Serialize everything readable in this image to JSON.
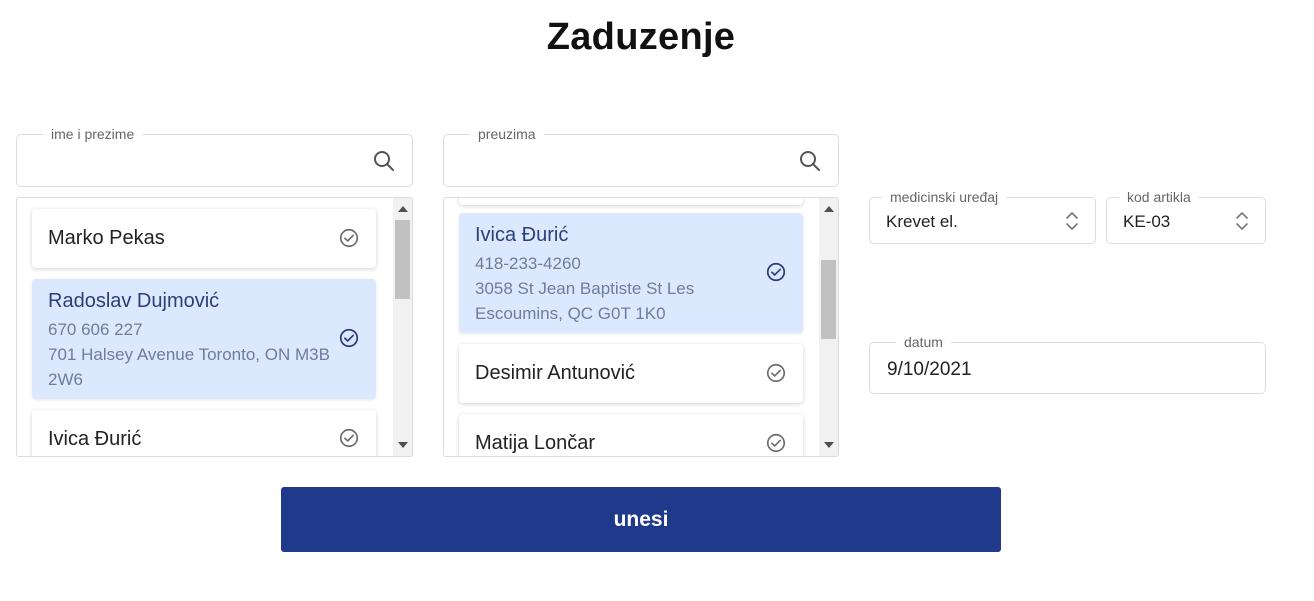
{
  "page": {
    "title": "Zaduzenje"
  },
  "left_search": {
    "label": "ime i prezime",
    "value": "",
    "placeholder": ""
  },
  "right_search": {
    "label": "preuzima",
    "value": "",
    "placeholder": ""
  },
  "left_list": {
    "items": [
      {
        "name": "Marko Pekas",
        "phone": "",
        "address1": "",
        "address2": "",
        "selected": false
      },
      {
        "name": "Radoslav Dujmović",
        "phone": "670 606 227",
        "address1": "701 Halsey Avenue Toronto, ON M3B",
        "address2": "2W6",
        "selected": true
      },
      {
        "name": "Ivica Đurić",
        "phone": "",
        "address1": "",
        "address2": "",
        "selected": false
      }
    ]
  },
  "right_list": {
    "items": [
      {
        "name": "Ivica Đurić",
        "phone": "418-233-4260",
        "address1": "3058 St Jean Baptiste St Les",
        "address2": "Escoumins, QC G0T 1K0",
        "selected": true
      },
      {
        "name": "Desimir Antunović",
        "phone": "",
        "address1": "",
        "address2": "",
        "selected": false
      },
      {
        "name": "Matija Lončar",
        "phone": "",
        "address1": "",
        "address2": "",
        "selected": false
      }
    ]
  },
  "device_select": {
    "label": "medicinski uređaj",
    "value": "Krevet el."
  },
  "code_select": {
    "label": "kod artikla",
    "value": "KE-03"
  },
  "date_field": {
    "label": "datum",
    "value": "9/10/2021"
  },
  "submit": {
    "label": "unesi"
  },
  "colors": {
    "primary": "#1f3a8a",
    "selected_bg": "#dbe8fd",
    "check_selected": "#2b3f7a",
    "check_default": "#6b6b6b"
  },
  "icons": {
    "search": "search-icon",
    "check": "check-circle-icon",
    "select": "unfold-icon"
  }
}
